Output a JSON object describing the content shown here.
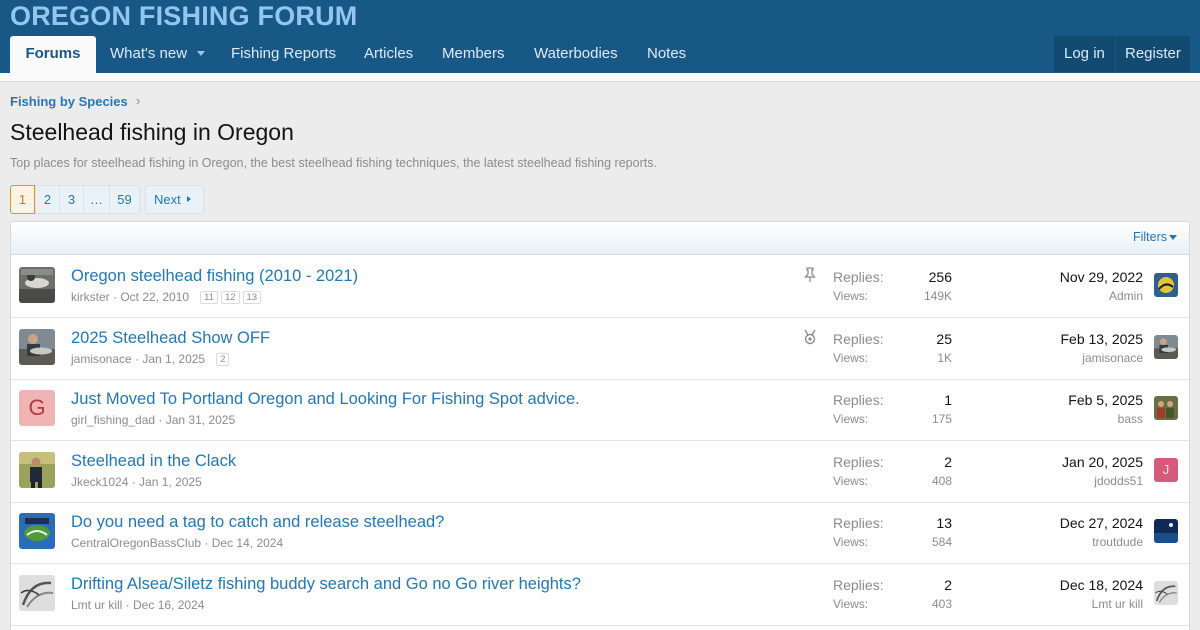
{
  "site": {
    "title": "OREGON FISHING FORUM"
  },
  "nav": {
    "tabs": [
      {
        "label": "Forums",
        "active": true
      },
      {
        "label": "What's new"
      },
      {
        "label": "Fishing Reports"
      },
      {
        "label": "Articles"
      },
      {
        "label": "Members"
      },
      {
        "label": "Waterbodies"
      },
      {
        "label": "Notes"
      }
    ],
    "login": "Log in",
    "register": "Register"
  },
  "breadcrumb": "Fishing by Species",
  "page": {
    "title": "Steelhead fishing in Oregon",
    "description": "Top places for steelhead fishing in Oregon, the best steelhead fishing techniques, the latest steelhead fishing reports."
  },
  "pagination": {
    "pages": [
      "1",
      "2",
      "3",
      "…",
      "59"
    ],
    "current": "1",
    "next": "Next"
  },
  "filters": "Filters",
  "labels": {
    "replies": "Replies:",
    "views": "Views:"
  },
  "colors": {
    "header_bg": "#185886",
    "title_color": "#93c6ef",
    "link": "#2577b1",
    "current_page": "#f2930d"
  },
  "threads": [
    {
      "title": "Oregon steelhead fishing (2010 - 2021)",
      "author": "kirkster",
      "date": "Oct 22, 2010",
      "pages": [
        "11",
        "12",
        "13"
      ],
      "status_icon": "pin-icon",
      "replies": "256",
      "views": "149K",
      "last_date": "Nov 29, 2022",
      "last_user": "Admin",
      "avatar": "photo-fish-icon",
      "last_avatar": "photo-logo-icon"
    },
    {
      "title": "2025 Steelhead Show OFF",
      "author": "jamisonace",
      "date": "Jan 1, 2025",
      "pages": [
        "2"
      ],
      "status_icon": "award-medal-icon",
      "replies": "25",
      "views": "1K",
      "last_date": "Feb 13, 2025",
      "last_user": "jamisonace",
      "avatar": "photo-angler-icon",
      "last_avatar": "photo-angler-icon"
    },
    {
      "title": "Just Moved To Portland Oregon and Looking For Fishing Spot advice.",
      "author": "girl_fishing_dad",
      "date": "Jan 31, 2025",
      "pages": [],
      "status_icon": "",
      "replies": "1",
      "views": "175",
      "last_date": "Feb 5, 2025",
      "last_user": "bass",
      "avatar_letter": "G",
      "avatar_bg": "#f0b4b4",
      "avatar_fg": "#b23a3a",
      "last_avatar": "photo-group-icon"
    },
    {
      "title": "Steelhead in the Clack",
      "author": "Jkeck1024",
      "date": "Jan 1, 2025",
      "pages": [],
      "status_icon": "",
      "replies": "2",
      "views": "408",
      "last_date": "Jan 20, 2025",
      "last_user": "jdodds51",
      "avatar": "photo-person-icon",
      "last_avatar_letter": "J",
      "last_avatar_bg": "#d65a7c",
      "last_avatar_fg": "#f8dfe6"
    },
    {
      "title": "Do you need a tag to catch and release steelhead?",
      "author": "CentralOregonBassClub",
      "date": "Dec 14, 2024",
      "pages": [],
      "status_icon": "",
      "replies": "13",
      "views": "584",
      "last_date": "Dec 27, 2024",
      "last_user": "troutdude",
      "avatar": "photo-club-logo-icon",
      "last_avatar": "photo-night-icon"
    },
    {
      "title": "Drifting Alsea/Siletz fishing buddy search and Go no Go river heights?",
      "author": "Lmt ur kill",
      "date": "Dec 16, 2024",
      "pages": [],
      "status_icon": "",
      "replies": "2",
      "views": "403",
      "last_date": "Dec 18, 2024",
      "last_user": "Lmt ur kill",
      "avatar": "photo-sketch-icon",
      "last_avatar": "photo-sketch-icon"
    }
  ]
}
